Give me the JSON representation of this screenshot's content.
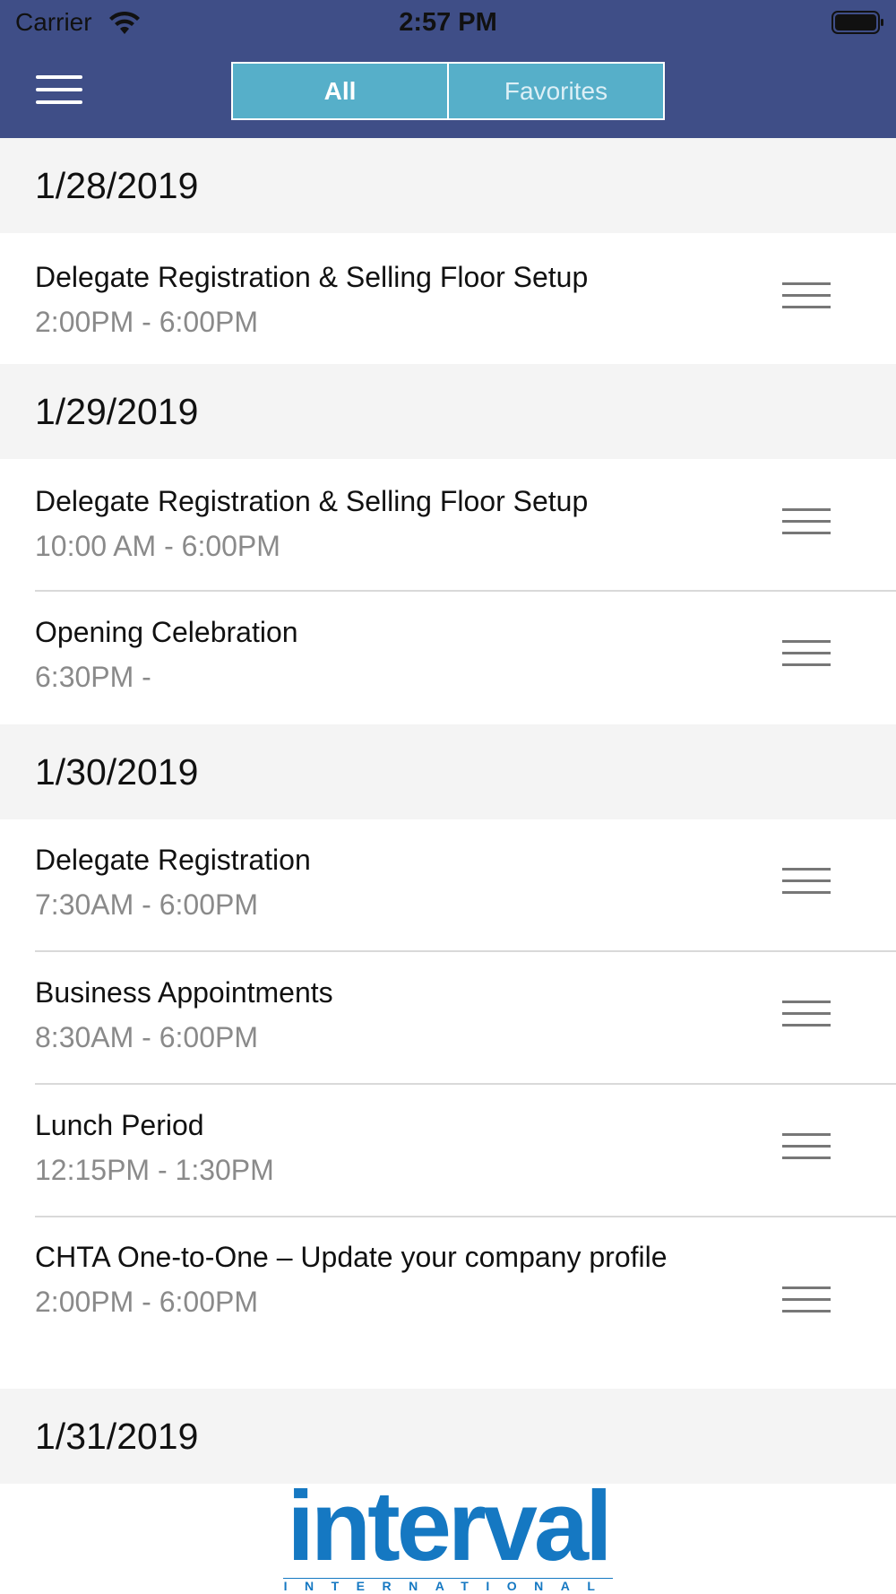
{
  "status_bar": {
    "carrier": "Carrier",
    "time": "2:57 PM",
    "wifi_icon": "wifi-icon",
    "battery_icon": "battery-full-icon"
  },
  "nav": {
    "menu_icon": "hamburger-menu-icon",
    "segments": [
      {
        "label": "All",
        "selected": true
      },
      {
        "label": "Favorites",
        "selected": false
      }
    ],
    "bar_color": "#3f4e87",
    "segment_color": "#56afc9"
  },
  "schedule": {
    "days": [
      {
        "date": "1/28/2019",
        "events": [
          {
            "title": "Delegate Registration & Selling Floor Setup",
            "time": "2:00PM - 6:00PM"
          }
        ]
      },
      {
        "date": "1/29/2019",
        "events": [
          {
            "title": "Delegate Registration & Selling Floor Setup",
            "time": "10:00 AM - 6:00PM"
          },
          {
            "title": "Opening Celebration",
            "time": "6:30PM -"
          }
        ]
      },
      {
        "date": "1/30/2019",
        "events": [
          {
            "title": "Delegate Registration",
            "time": "7:30AM - 6:00PM"
          },
          {
            "title": "Business Appointments",
            "time": "8:30AM - 6:00PM"
          },
          {
            "title": "Lunch Period",
            "time": "12:15PM - 1:30PM"
          },
          {
            "title": "CHTA One-to-One – Update your company profile",
            "time": "2:00PM - 6:00PM"
          }
        ]
      },
      {
        "date": "1/31/2019",
        "events": []
      }
    ],
    "reorder_icon": "reorder-handle-icon"
  },
  "footer": {
    "logo_text": "interval",
    "logo_subtext": "INTERNATIONAL",
    "logo_color": "#1578c2"
  }
}
